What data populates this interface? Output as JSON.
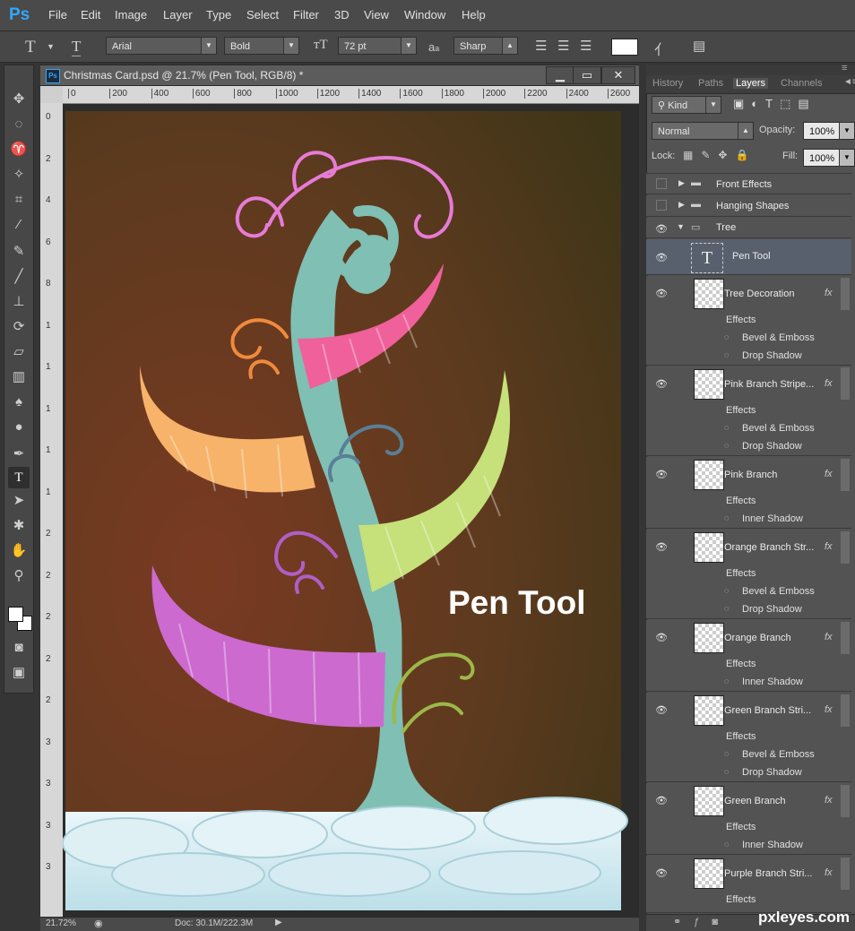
{
  "app": {
    "logo": "Ps"
  },
  "menu": [
    "File",
    "Edit",
    "Image",
    "Layer",
    "Type",
    "Select",
    "Filter",
    "3D",
    "View",
    "Window",
    "Help"
  ],
  "options": {
    "tool_icon": "T",
    "font_family": "Arial",
    "font_style": "Bold",
    "font_size": "72 pt",
    "aa_label": "a",
    "antialias": "Sharp",
    "swatch_color": "#ffffff"
  },
  "document": {
    "title": "Christmas Card.psd @ 21.7% (Pen Tool, RGB/8) *",
    "ps_badge": "Ps",
    "minimize": "▁",
    "restore": "▭",
    "close": "✕",
    "ruler_h": [
      "0",
      "200",
      "400",
      "600",
      "800",
      "1000",
      "1200",
      "1400",
      "1600",
      "1800",
      "2000",
      "2200",
      "2400",
      "2600"
    ],
    "ruler_v": [
      "0",
      "2",
      "4",
      "6",
      "8",
      "1",
      "1",
      "1",
      "1",
      "1",
      "2",
      "2",
      "2",
      "2",
      "2",
      "3",
      "3",
      "3",
      "3"
    ],
    "canvas_text": "Pen Tool",
    "zoom": "21.72%",
    "doc_size": "Doc: 30.1M/222.3M"
  },
  "panel": {
    "tabs": [
      "History",
      "Paths",
      "Layers",
      "Channels"
    ],
    "kind_label": "Kind",
    "blend_mode": "Normal",
    "opacity_label": "Opacity:",
    "opacity_value": "100%",
    "lock_label": "Lock:",
    "fill_label": "Fill:",
    "fill_value": "100%",
    "groups": [
      {
        "name": "Front Effects"
      },
      {
        "name": "Hanging Shapes"
      },
      {
        "name": "Tree"
      }
    ],
    "text_layer": {
      "name": "Pen Tool",
      "glyph": "T"
    },
    "layers": [
      {
        "name": "Tree Decoration",
        "effects_label": "Effects",
        "effects": [
          "Bevel & Emboss",
          "Drop Shadow"
        ]
      },
      {
        "name": "Pink Branch Stripe...",
        "effects_label": "Effects",
        "effects": [
          "Bevel & Emboss",
          "Drop Shadow"
        ]
      },
      {
        "name": "Pink Branch",
        "effects_label": "Effects",
        "effects": [
          "Inner Shadow"
        ]
      },
      {
        "name": "Orange Branch Str...",
        "effects_label": "Effects",
        "effects": [
          "Bevel & Emboss",
          "Drop Shadow"
        ]
      },
      {
        "name": "Orange Branch",
        "effects_label": "Effects",
        "effects": [
          "Inner Shadow"
        ]
      },
      {
        "name": "Green Branch Stri...",
        "effects_label": "Effects",
        "effects": [
          "Bevel & Emboss",
          "Drop Shadow"
        ]
      },
      {
        "name": "Green Branch",
        "effects_label": "Effects",
        "effects": [
          "Inner Shadow"
        ]
      },
      {
        "name": "Purple Branch Stri...",
        "effects_label": "Effects",
        "effects": []
      }
    ],
    "fx_label": "fx"
  },
  "watermark": "pxleyes.com",
  "colors": {
    "accent": "#31a8ff",
    "tree": "#7fbfb4",
    "pink": "#f0609a",
    "orange": "#f7b36a",
    "green": "#c6e07a",
    "purple": "#cc6ad0"
  }
}
